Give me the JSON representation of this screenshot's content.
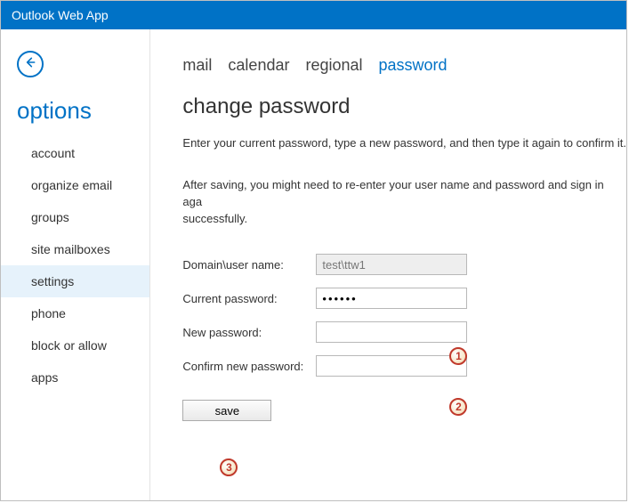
{
  "titlebar": {
    "app_name": "Outlook Web App"
  },
  "sidebar": {
    "options_heading": "options",
    "items": [
      {
        "label": "account"
      },
      {
        "label": "organize email"
      },
      {
        "label": "groups"
      },
      {
        "label": "site mailboxes"
      },
      {
        "label": "settings"
      },
      {
        "label": "phone"
      },
      {
        "label": "block or allow"
      },
      {
        "label": "apps"
      }
    ],
    "active_index": 4
  },
  "tabs": {
    "items": [
      {
        "label": "mail"
      },
      {
        "label": "calendar"
      },
      {
        "label": "regional"
      },
      {
        "label": "password"
      }
    ],
    "active_index": 3
  },
  "page": {
    "title": "change password",
    "instruction1": "Enter your current password, type a new password, and then type it again to confirm it.",
    "instruction2a": "After saving, you might need to re-enter your user name and password and sign in aga",
    "instruction2b": "successfully."
  },
  "form": {
    "domain_user_label": "Domain\\user name:",
    "domain_user_value": "test\\ttw1",
    "current_pw_label": "Current password:",
    "current_pw_value": "••••••",
    "new_pw_label": "New password:",
    "new_pw_value": "",
    "confirm_pw_label": "Confirm new password:",
    "confirm_pw_value": "",
    "save_label": "save"
  },
  "callouts": {
    "c1": "1",
    "c2": "2",
    "c3": "3"
  }
}
